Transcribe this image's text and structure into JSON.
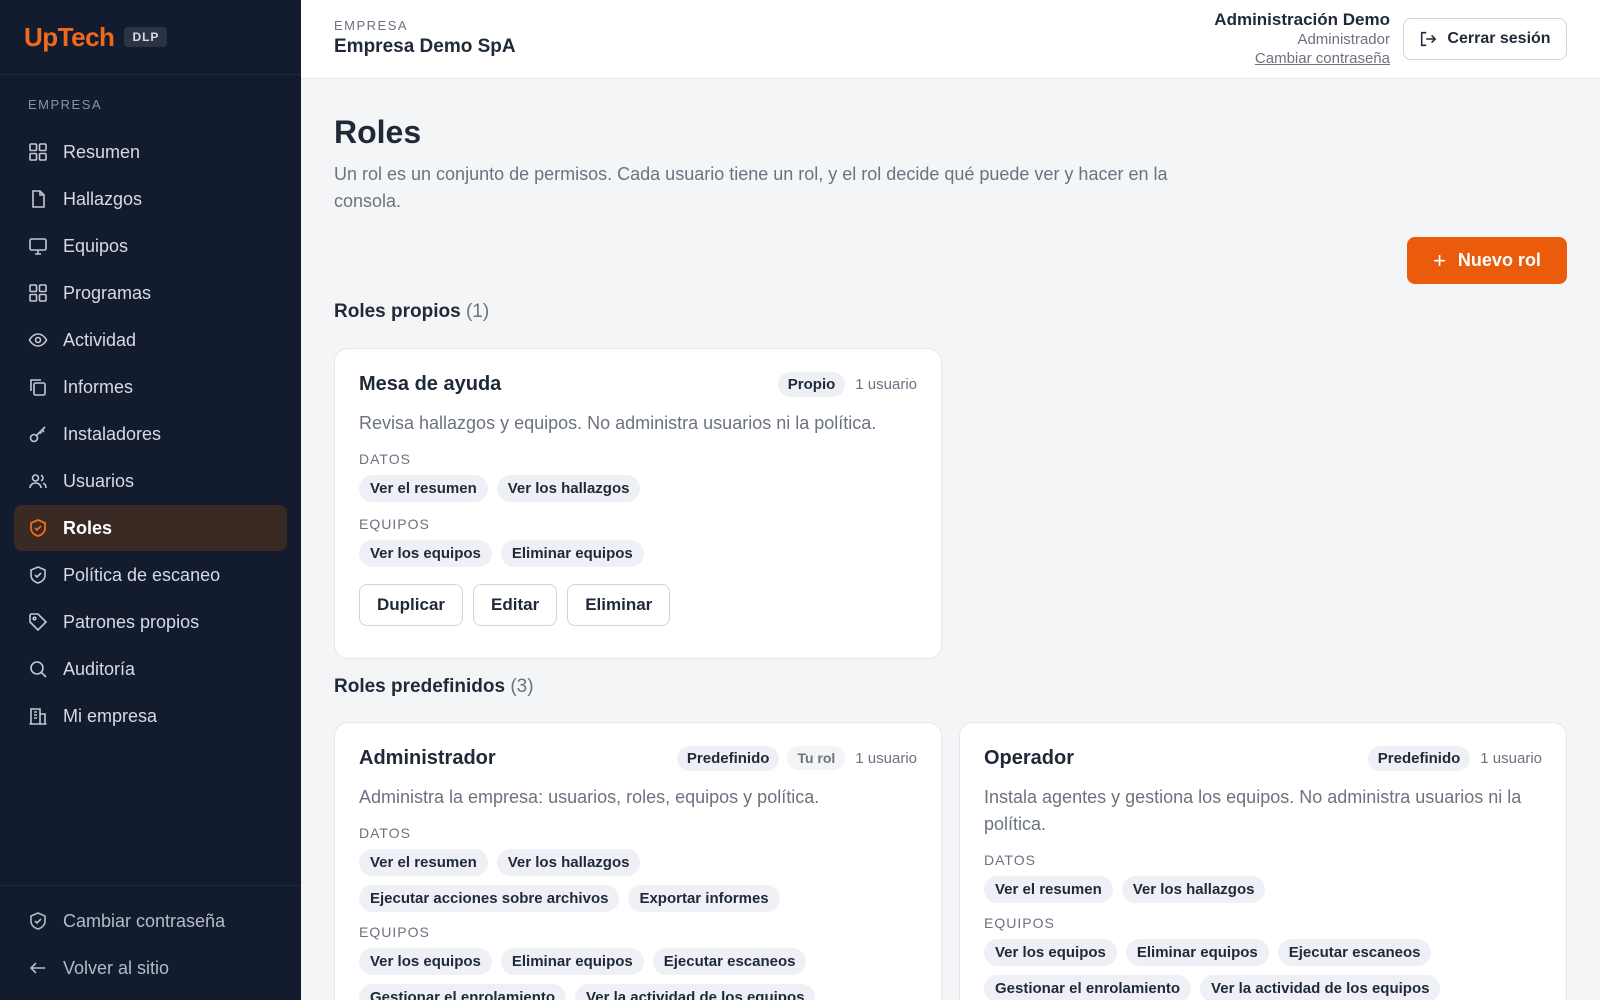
{
  "brand": {
    "logo_up": "Up",
    "logo_tech": "Tech",
    "badge": "DLP"
  },
  "sidebar": {
    "section_label": "EMPRESA",
    "items": [
      {
        "label": "Resumen",
        "icon": "grid-icon"
      },
      {
        "label": "Hallazgos",
        "icon": "file-icon"
      },
      {
        "label": "Equipos",
        "icon": "monitor-icon"
      },
      {
        "label": "Programas",
        "icon": "apps-icon"
      },
      {
        "label": "Actividad",
        "icon": "eye-icon"
      },
      {
        "label": "Informes",
        "icon": "copy-icon"
      },
      {
        "label": "Instaladores",
        "icon": "key-icon"
      },
      {
        "label": "Usuarios",
        "icon": "users-icon"
      },
      {
        "label": "Roles",
        "icon": "shield-check-icon",
        "active": true
      },
      {
        "label": "Política de escaneo",
        "icon": "shield-icon"
      },
      {
        "label": "Patrones propios",
        "icon": "tag-icon"
      },
      {
        "label": "Auditoría",
        "icon": "search-icon"
      },
      {
        "label": "Mi empresa",
        "icon": "building-icon"
      }
    ],
    "bottom": [
      {
        "label": "Cambiar contraseña",
        "icon": "shield-icon"
      },
      {
        "label": "Volver al sitio",
        "icon": "arrow-left-icon"
      }
    ]
  },
  "header": {
    "company_label": "EMPRESA",
    "company_name": "Empresa Demo SpA",
    "user_name": "Administración Demo",
    "user_role": "Administrador",
    "change_password": "Cambiar contraseña",
    "logout": "Cerrar sesión"
  },
  "page": {
    "title": "Roles",
    "description": "Un rol es un conjunto de permisos. Cada usuario tiene un rol, y el rol decide qué puede ver y hacer en la consola.",
    "new_role": "Nuevo rol"
  },
  "own_roles": {
    "title": "Roles propios",
    "count": "(1)",
    "roles": [
      {
        "name": "Mesa de ayuda",
        "badge": "Propio",
        "users": "1 usuario",
        "description": "Revisa hallazgos y equipos. No administra usuarios ni la política.",
        "groups": [
          {
            "label": "DATOS",
            "chips": [
              "Ver el resumen",
              "Ver los hallazgos"
            ]
          },
          {
            "label": "EQUIPOS",
            "chips": [
              "Ver los equipos",
              "Eliminar equipos"
            ]
          }
        ],
        "actions": [
          "Duplicar",
          "Editar",
          "Eliminar"
        ]
      }
    ]
  },
  "predefined_roles": {
    "title": "Roles predefinidos",
    "count": "(3)",
    "roles": [
      {
        "name": "Administrador",
        "badge": "Predefinido",
        "badge2": "Tu rol",
        "users": "1 usuario",
        "description": "Administra la empresa: usuarios, roles, equipos y política.",
        "groups": [
          {
            "label": "DATOS",
            "chips": [
              "Ver el resumen",
              "Ver los hallazgos",
              "Ejecutar acciones sobre archivos",
              "Exportar informes"
            ]
          },
          {
            "label": "EQUIPOS",
            "chips": [
              "Ver los equipos",
              "Eliminar equipos",
              "Ejecutar escaneos",
              "Gestionar el enrolamiento",
              "Ver la actividad de los equipos"
            ]
          }
        ]
      },
      {
        "name": "Operador",
        "badge": "Predefinido",
        "users": "1 usuario",
        "description": "Instala agentes y gestiona los equipos. No administra usuarios ni la política.",
        "groups": [
          {
            "label": "DATOS",
            "chips": [
              "Ver el resumen",
              "Ver los hallazgos"
            ]
          },
          {
            "label": "EQUIPOS",
            "chips": [
              "Ver los equipos",
              "Eliminar equipos",
              "Ejecutar escaneos",
              "Gestionar el enrolamiento",
              "Ver la actividad de los equipos"
            ]
          }
        ]
      }
    ]
  },
  "colors": {
    "accent": "#ea5b0c",
    "sidebar_bg": "#131c2e",
    "active_bg": "#3a2a24"
  }
}
